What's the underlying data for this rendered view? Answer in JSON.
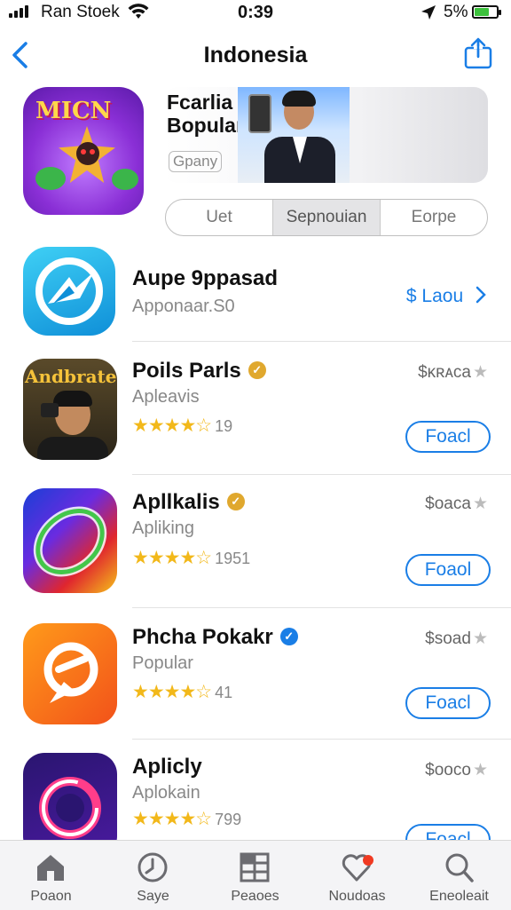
{
  "status_bar": {
    "carrier": "Ran Stoek",
    "time": "0:39",
    "battery": "5%"
  },
  "nav": {
    "title": "Indonesia"
  },
  "hero": {
    "icon_text": "MICN",
    "banner_title_line1": "Fcarlia",
    "banner_title_line2": "Bopular",
    "banner_subtitle": "Gpany"
  },
  "segments": [
    "Uet",
    "Sepnouian",
    "Eorpe"
  ],
  "apps": [
    {
      "name": "Aupe 9ppasad",
      "category": "Apponaar.S0",
      "price": "$ Laou",
      "icon": "bird-icon",
      "accent": "#1aa3e8"
    },
    {
      "name": "Poils Parls",
      "category": "Apleavis",
      "stars": "★★★★☆",
      "rating_count": "19",
      "price": "$ĸʀᴀca",
      "button": "Foacl",
      "icon": "person-photo-icon",
      "icon_text": "Andbrate",
      "badge_color": "#e0a82e"
    },
    {
      "name": "Apllkalis",
      "category": "Apliking",
      "stars": "★★★★☆",
      "rating_count": "1951",
      "price": "$oaca",
      "button": "Foaol",
      "icon": "rainbow-ring-icon",
      "badge_color": "#e0a82e"
    },
    {
      "name": "Phcha Pokakr",
      "category": "Popular",
      "stars": "★★★★☆",
      "rating_count": "41",
      "price": "$soad",
      "button": "Foacl",
      "icon": "orange-pin-icon",
      "badge_color": "#1a7ee6"
    },
    {
      "name": "Aplicly",
      "category": "Aplokain",
      "stars": "★★★★☆",
      "rating_count": "799",
      "price": "$ooco",
      "button": "Foacl",
      "icon": "purple-ring-icon"
    }
  ],
  "tabbar": [
    {
      "label": "Poaon",
      "icon": "home-icon"
    },
    {
      "label": "Saye",
      "icon": "clock-icon"
    },
    {
      "label": "Peaoes",
      "icon": "grid-icon"
    },
    {
      "label": "Noudoas",
      "icon": "heart-notification-icon"
    },
    {
      "label": "Eneoleait",
      "icon": "search-icon"
    }
  ],
  "colors": {
    "accent": "#1a7ee6",
    "star": "#f2b81a",
    "battery": "#3cc13c"
  }
}
